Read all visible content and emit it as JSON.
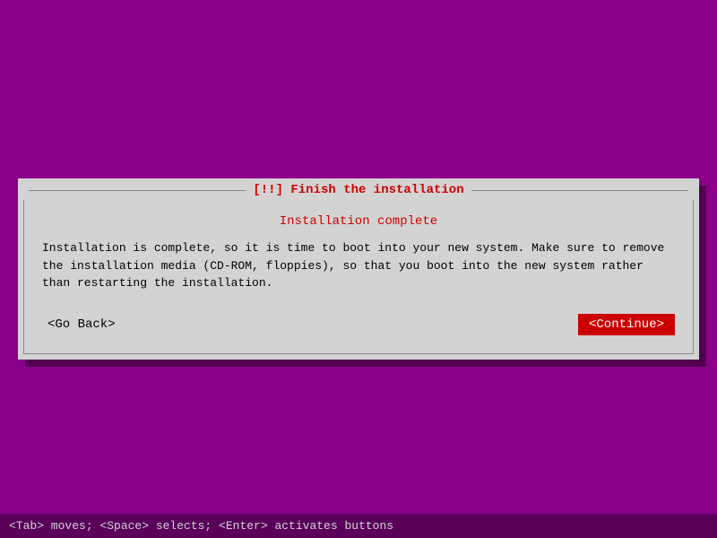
{
  "dialog": {
    "title": "[!!] Finish the installation",
    "subtitle": "Installation complete",
    "body_text": "Installation is complete, so it is time to boot into your new system. Make sure to remove\nthe installation media (CD-ROM, floppies), so that you boot into the new system rather\nthan restarting the installation.",
    "go_back_label": "<Go Back>",
    "continue_label": "<Continue>"
  },
  "bottom_bar": {
    "help_text": "<Tab> moves; <Space> selects; <Enter> activates buttons"
  }
}
